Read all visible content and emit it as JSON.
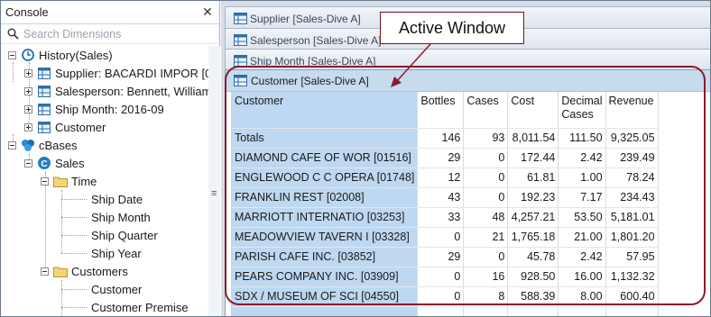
{
  "console": {
    "title": "Console",
    "close_glyph": "✕",
    "search_placeholder": "Search Dimensions",
    "tree": [
      {
        "label": "History(Sales)",
        "icon": "history-icon"
      },
      {
        "label": "Supplier: BACARDI IMPOR [0",
        "icon": "table-icon"
      },
      {
        "label": "Salesperson: Bennett, William",
        "icon": "table-icon"
      },
      {
        "label": "Ship Month: 2016-09",
        "icon": "table-icon"
      },
      {
        "label": "Customer",
        "icon": "table-icon"
      },
      {
        "label": "cBases",
        "icon": "cbases-icon"
      },
      {
        "label": "Sales",
        "icon": "cube-icon"
      },
      {
        "label": "Time",
        "icon": "folder-icon"
      },
      {
        "label": "Ship Date",
        "icon": ""
      },
      {
        "label": "Ship Month",
        "icon": ""
      },
      {
        "label": "Ship Quarter",
        "icon": ""
      },
      {
        "label": "Ship Year",
        "icon": ""
      },
      {
        "label": "Customers",
        "icon": "folder-icon"
      },
      {
        "label": "Customer",
        "icon": ""
      },
      {
        "label": "Customer Premise",
        "icon": ""
      }
    ]
  },
  "tabs": [
    {
      "label": "Supplier [Sales-Dive A]"
    },
    {
      "label": "Salesperson [Sales-Dive A]"
    },
    {
      "label": "Ship Month [Sales-Dive A]"
    }
  ],
  "active_window": {
    "title": "Customer [Sales-Dive A]",
    "columns": [
      "Customer",
      "Bottles",
      "Cases",
      "Cost",
      "Decimal Cases",
      "Revenue"
    ],
    "rows": [
      [
        "Totals",
        "146",
        "93",
        "8,011.54",
        "111.50",
        "9,325.05"
      ],
      [
        "DIAMOND CAFE OF WOR [01516]",
        "29",
        "0",
        "172.44",
        "2.42",
        "239.49"
      ],
      [
        "ENGLEWOOD C C OPERA [01748]",
        "12",
        "0",
        "61.81",
        "1.00",
        "78.24"
      ],
      [
        "FRANKLIN REST [02008]",
        "43",
        "0",
        "192.23",
        "7.17",
        "234.43"
      ],
      [
        "MARRIOTT INTERNATIO [03253]",
        "33",
        "48",
        "4,257.21",
        "53.50",
        "5,181.01"
      ],
      [
        "MEADOWVIEW TAVERN I [03328]",
        "0",
        "21",
        "1,765.18",
        "21.00",
        "1,801.20"
      ],
      [
        "PARISH CAFE INC. [03852]",
        "29",
        "0",
        "45.78",
        "2.42",
        "57.95"
      ],
      [
        "PEARS COMPANY INC. [03909]",
        "0",
        "16",
        "928.50",
        "16.00",
        "1,132.32"
      ],
      [
        "SDX / MUSEUM OF SCI [04550]",
        "0",
        "8",
        "588.39",
        "8.00",
        "600.40"
      ]
    ]
  },
  "annotation": {
    "label": "Active Window",
    "color": "#8b1a2b"
  },
  "colors": {
    "row_header_bg": "#bfd8f1",
    "active_title_bg": "#c7dbef",
    "workspace_bg": "#d4dde8"
  }
}
